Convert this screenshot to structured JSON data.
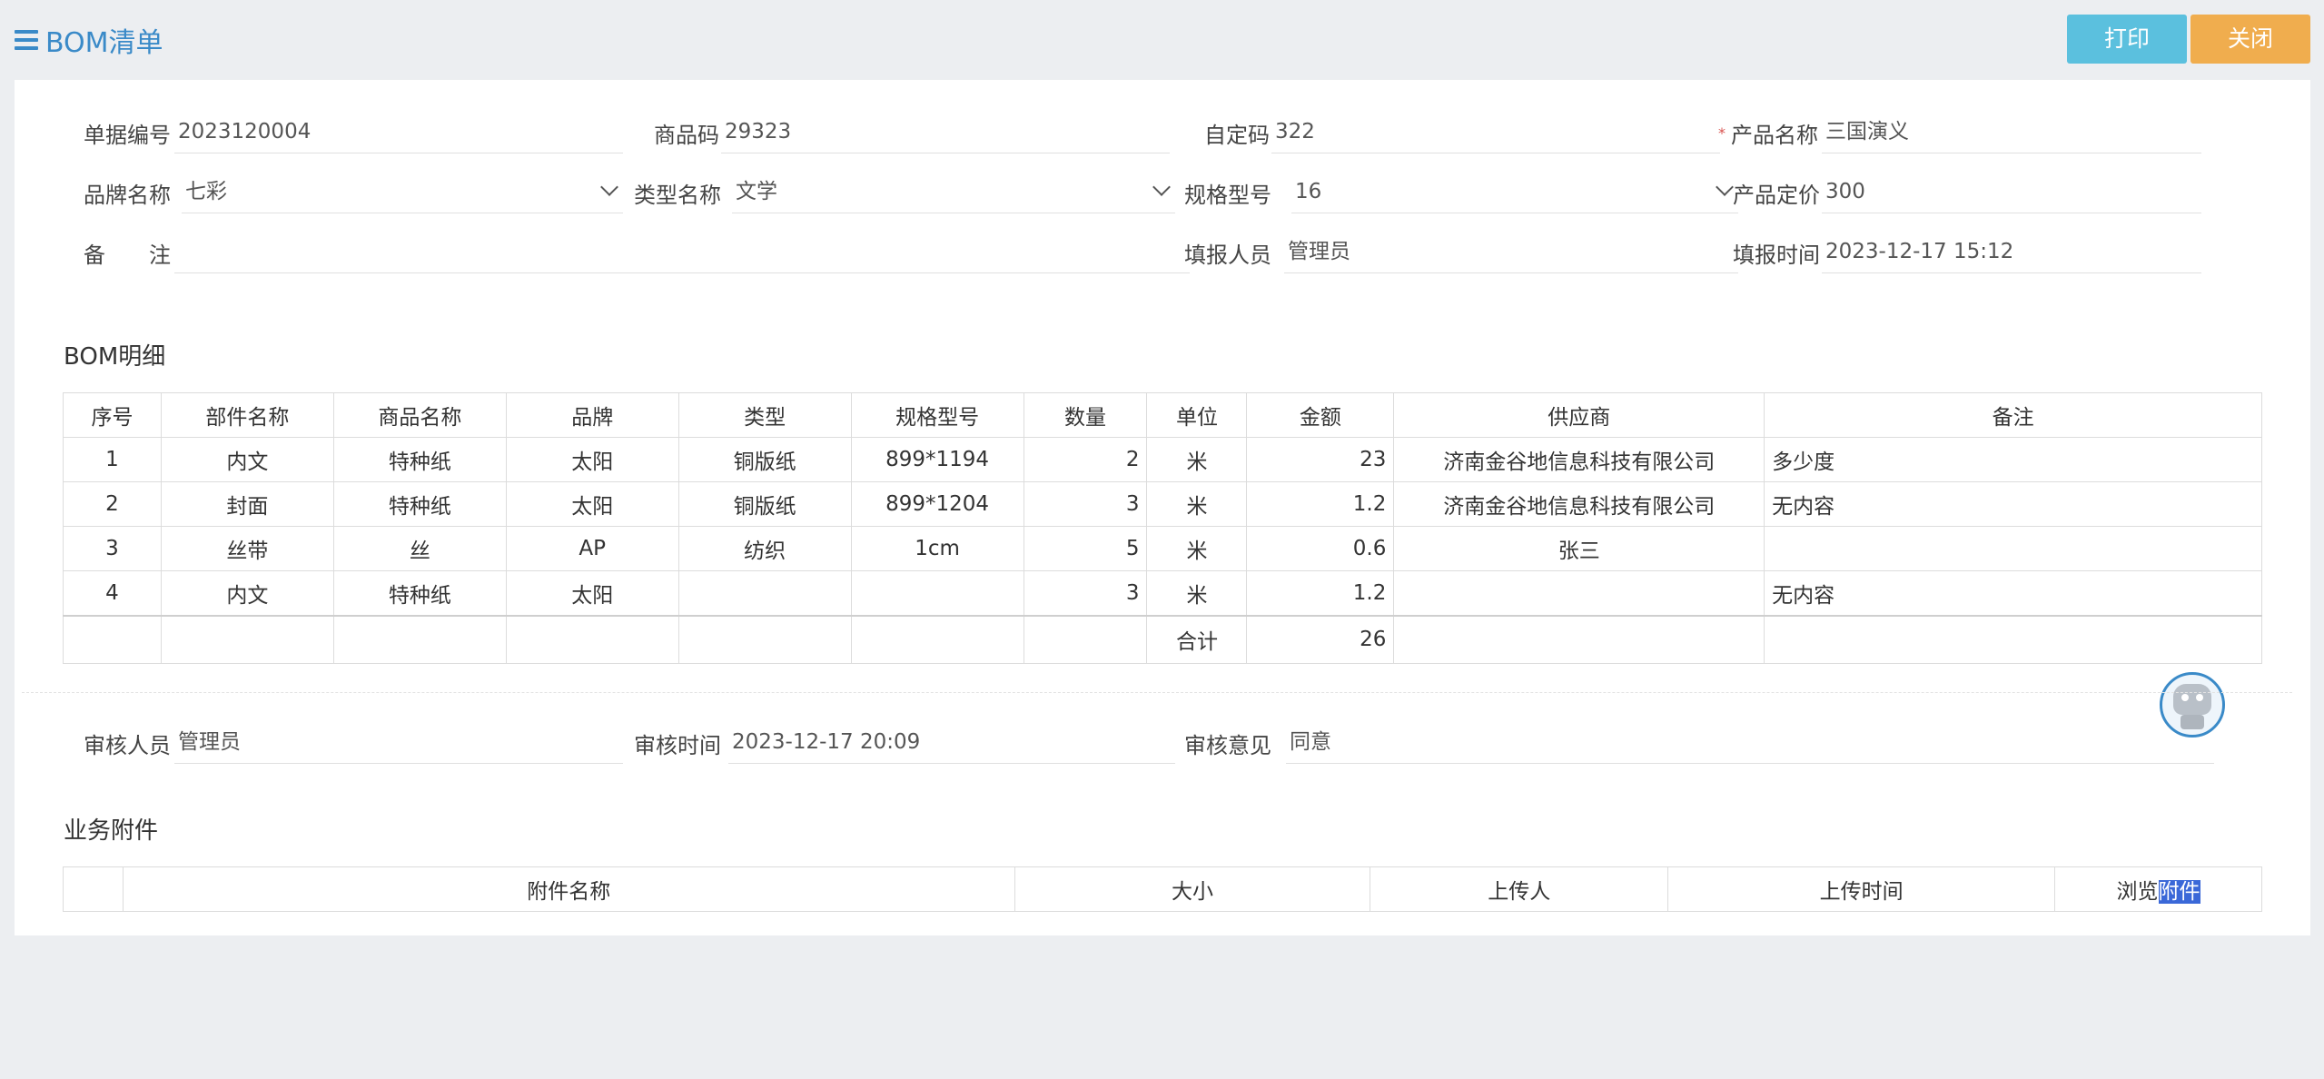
{
  "header": {
    "title": "BOM清单",
    "print_label": "打印",
    "close_label": "关闭"
  },
  "form": {
    "doc_no": {
      "label": "单据编号",
      "value": "2023120004"
    },
    "product_code": {
      "label": "商品码",
      "value": "29323"
    },
    "custom_code": {
      "label": "自定码",
      "value": "322"
    },
    "product_name": {
      "required_mark": "*",
      "label": "产品名称",
      "value": "三国演义"
    },
    "brand": {
      "label": "品牌名称",
      "value": "七彩"
    },
    "type": {
      "label": "类型名称",
      "value": "文学"
    },
    "spec": {
      "label": "规格型号",
      "value": "16"
    },
    "price": {
      "label": "产品定价",
      "value": "300"
    },
    "remark": {
      "label": "备　　注",
      "value": ""
    },
    "reporter": {
      "label": "填报人员",
      "value": "管理员"
    },
    "report_time": {
      "label": "填报时间",
      "value": "2023-12-17 15:12"
    }
  },
  "bom": {
    "title": "BOM明细",
    "columns": [
      "序号",
      "部件名称",
      "商品名称",
      "品牌",
      "类型",
      "规格型号",
      "数量",
      "单位",
      "金额",
      "供应商",
      "备注"
    ],
    "rows": [
      [
        "1",
        "内文",
        "特种纸",
        "太阳",
        "铜版纸",
        "899*1194",
        "2",
        "米",
        "23",
        "济南金谷地信息科技有限公司",
        "多少度"
      ],
      [
        "2",
        "封面",
        "特种纸",
        "太阳",
        "铜版纸",
        "899*1204",
        "3",
        "米",
        "1.2",
        "济南金谷地信息科技有限公司",
        "无内容"
      ],
      [
        "3",
        "丝带",
        "丝",
        "AP",
        "纺织",
        "1cm",
        "5",
        "米",
        "0.6",
        "张三",
        ""
      ],
      [
        "4",
        "内文",
        "特种纸",
        "太阳",
        "",
        "",
        "3",
        "米",
        "1.2",
        "",
        "无内容"
      ]
    ],
    "total_label": "合计",
    "total_value": "26"
  },
  "audit": {
    "auditor": {
      "label": "审核人员",
      "value": "管理员"
    },
    "audit_time": {
      "label": "审核时间",
      "value": "2023-12-17 20:09"
    },
    "opinion": {
      "label": "审核意见",
      "value": "同意"
    }
  },
  "attachments": {
    "title": "业务附件",
    "columns": [
      "",
      "附件名称",
      "大小",
      "上传人",
      "上传时间"
    ],
    "browse_prefix": "浏览",
    "browse_highlight": "附件"
  }
}
